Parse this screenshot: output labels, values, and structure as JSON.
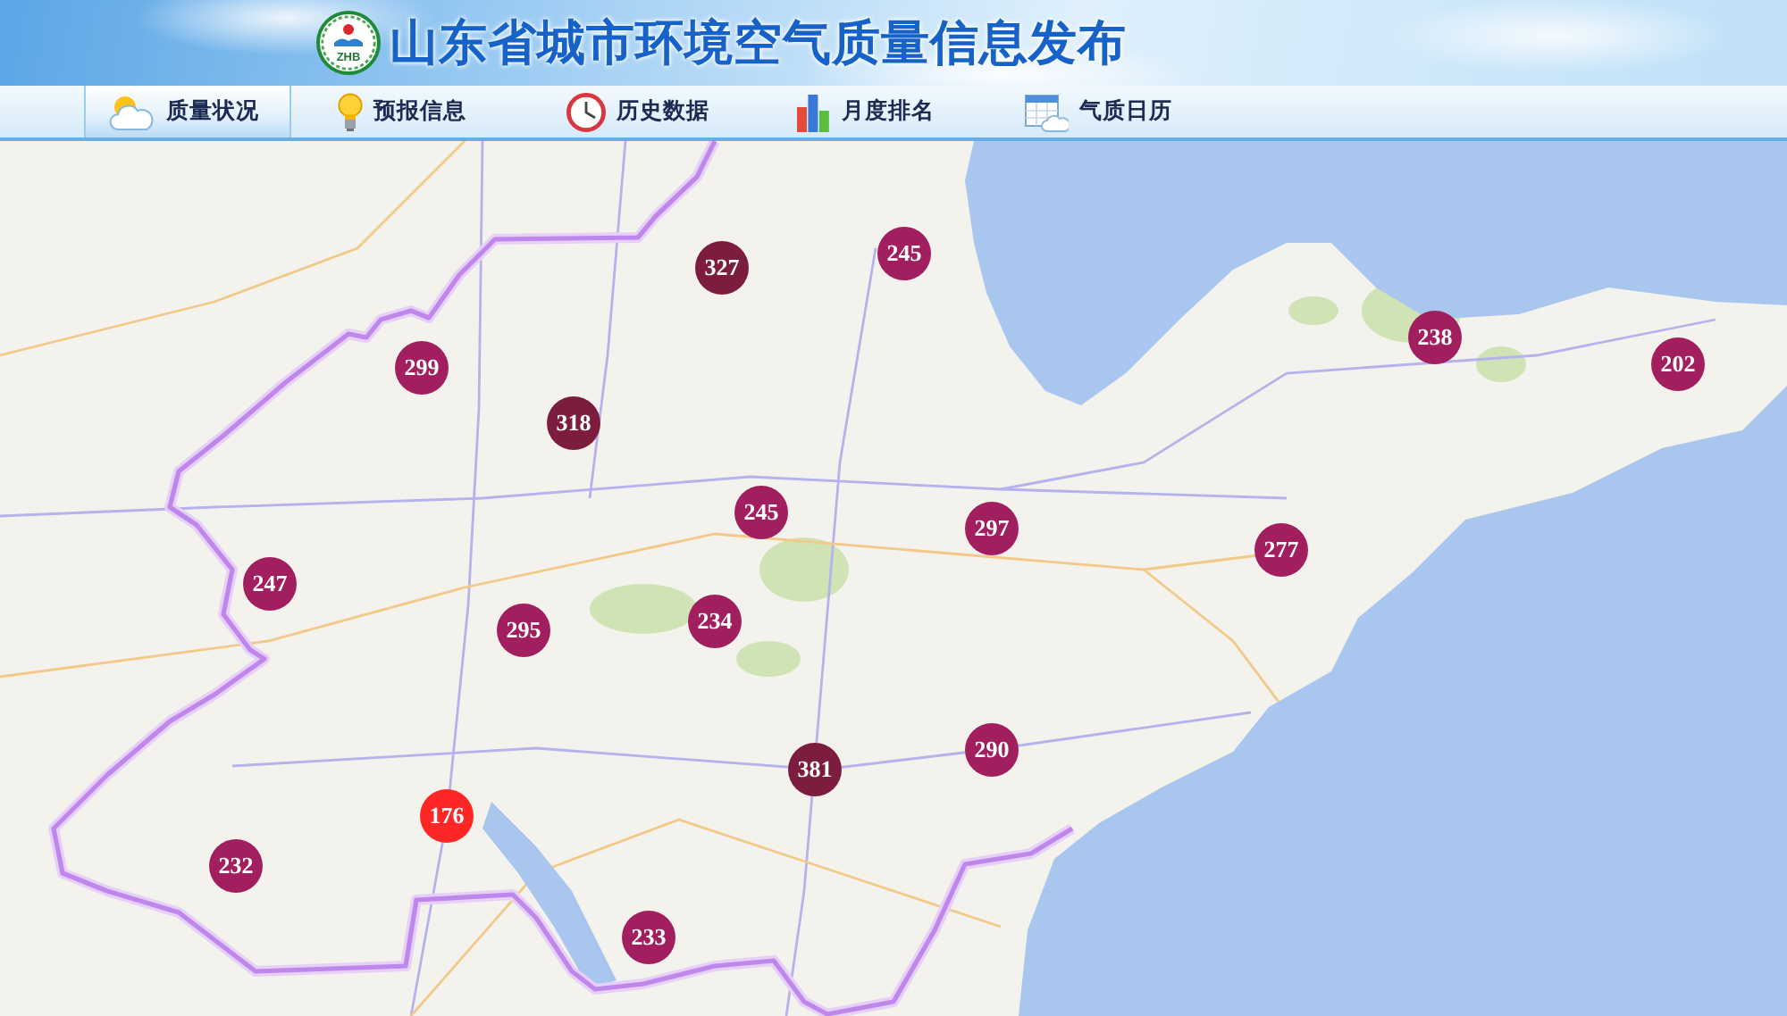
{
  "header": {
    "logo": {
      "text": "ZHB"
    },
    "title": "山东省城市环境空气质量信息发布"
  },
  "tabs": [
    {
      "label": "质量状况",
      "kind": "weather",
      "selected": true
    },
    {
      "label": "预报信息",
      "kind": "forecast",
      "selected": false
    },
    {
      "label": "历史数据",
      "kind": "history",
      "selected": false
    },
    {
      "label": "月度排名",
      "kind": "ranking",
      "selected": false
    },
    {
      "label": "气质日历",
      "kind": "calendar",
      "selected": false
    }
  ],
  "map": {
    "markers": [
      {
        "value": "245",
        "color": "#a11f5f"
      },
      {
        "value": "327",
        "color": "#7c1c3f"
      },
      {
        "value": "238",
        "color": "#a11f5f"
      },
      {
        "value": "299",
        "color": "#a11f5f"
      },
      {
        "value": "202",
        "color": "#a11f5f"
      },
      {
        "value": "318",
        "color": "#7c1c3f"
      },
      {
        "value": "245",
        "color": "#a11f5f"
      },
      {
        "value": "297",
        "color": "#a11f5f"
      },
      {
        "value": "277",
        "color": "#a11f5f"
      },
      {
        "value": "247",
        "color": "#a11f5f"
      },
      {
        "value": "234",
        "color": "#a11f5f"
      },
      {
        "value": "295",
        "color": "#a11f5f"
      },
      {
        "value": "290",
        "color": "#a11f5f"
      },
      {
        "value": "381",
        "color": "#7c1c3f"
      },
      {
        "value": "176",
        "color": "#ff2626"
      },
      {
        "value": "232",
        "color": "#a11f5f"
      },
      {
        "value": "233",
        "color": "#a11f5f"
      }
    ]
  }
}
